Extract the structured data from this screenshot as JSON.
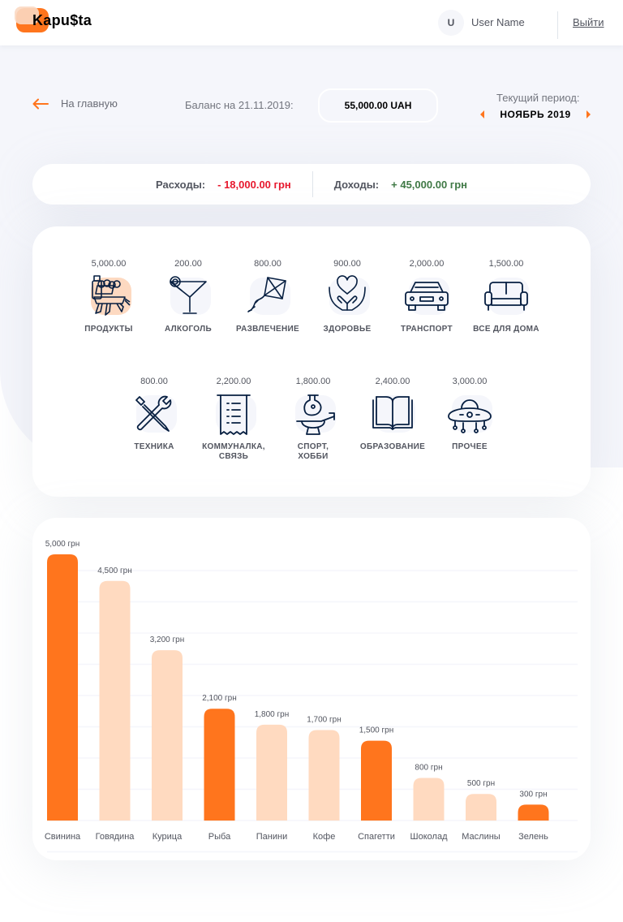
{
  "header": {
    "logo": "Kapu$ta",
    "avatar_initial": "U",
    "user_name": "User Name",
    "logout_label": "Выйти"
  },
  "nav": {
    "back_label": "На главную",
    "balance_label": "Баланс на 21.11.2019:",
    "balance_value": "55,000.00 UAH",
    "period_label": "Текущий период:",
    "period_value": "НОЯБРЬ 2019"
  },
  "summary": {
    "expenses_label": "Расходы:",
    "expenses_value": "- 18,000.00 грн",
    "income_label": "Доходы:",
    "income_value": "+ 45,000.00 грн"
  },
  "colors": {
    "accent": "#ff751d",
    "accent_light": "#ffdac0",
    "expense": "#e7192e",
    "income": "#407946",
    "icon": "#071f41"
  },
  "categories": [
    {
      "amount": "5,000.00",
      "name": "ПРОДУКТЫ",
      "icon": "groceries-icon",
      "active": true
    },
    {
      "amount": "200.00",
      "name": "АЛКОГОЛЬ",
      "icon": "cocktail-icon"
    },
    {
      "amount": "800.00",
      "name": "РАЗВЛЕЧЕНИЕ",
      "icon": "kite-icon"
    },
    {
      "amount": "900.00",
      "name": "ЗДОРОВЬЕ",
      "icon": "health-hands-icon"
    },
    {
      "amount": "2,000.00",
      "name": "ТРАНСПОРТ",
      "icon": "car-icon"
    },
    {
      "amount": "1,500.00",
      "name": "ВСЕ ДЛЯ ДОМА",
      "icon": "sofa-icon"
    },
    {
      "amount": "800.00",
      "name": "ТЕХНИКА",
      "icon": "tools-icon"
    },
    {
      "amount": "2,200.00",
      "name": "КОММУНАЛКА, СВЯЗЬ",
      "name_lines": [
        "КОММУНАЛКА,",
        "СВЯЗЬ"
      ],
      "icon": "receipt-icon"
    },
    {
      "amount": "1,800.00",
      "name": "СПОРТ, ХОББИ",
      "name_lines": [
        "СПОРТ,",
        "ХОББИ"
      ],
      "icon": "pottery-icon"
    },
    {
      "amount": "2,400.00",
      "name": "ОБРАЗОВАНИЕ",
      "icon": "book-icon"
    },
    {
      "amount": "3,000.00",
      "name": "ПРОЧЕЕ",
      "icon": "ufo-icon"
    }
  ],
  "chart_data": {
    "type": "bar",
    "categories": [
      "Свинина",
      "Говядина",
      "Курица",
      "Рыба",
      "Панини",
      "Кофе",
      "Спагетти",
      "Шоколад",
      "Маслины",
      "Зелень"
    ],
    "values": [
      5000,
      4500,
      3200,
      2100,
      1800,
      1700,
      1500,
      800,
      500,
      300
    ],
    "value_labels": [
      "5,000 грн",
      "4,500 грн",
      "3,200 грн",
      "2,100 грн",
      "1,800 грн",
      "1,700 грн",
      "1,500 грн",
      "800 грн",
      "500 грн",
      "300 грн"
    ],
    "highlighted": [
      true,
      false,
      false,
      true,
      false,
      false,
      true,
      false,
      false,
      true
    ],
    "ylim": [
      0,
      5000
    ],
    "grid": true,
    "title": "",
    "xlabel": "",
    "ylabel": ""
  }
}
